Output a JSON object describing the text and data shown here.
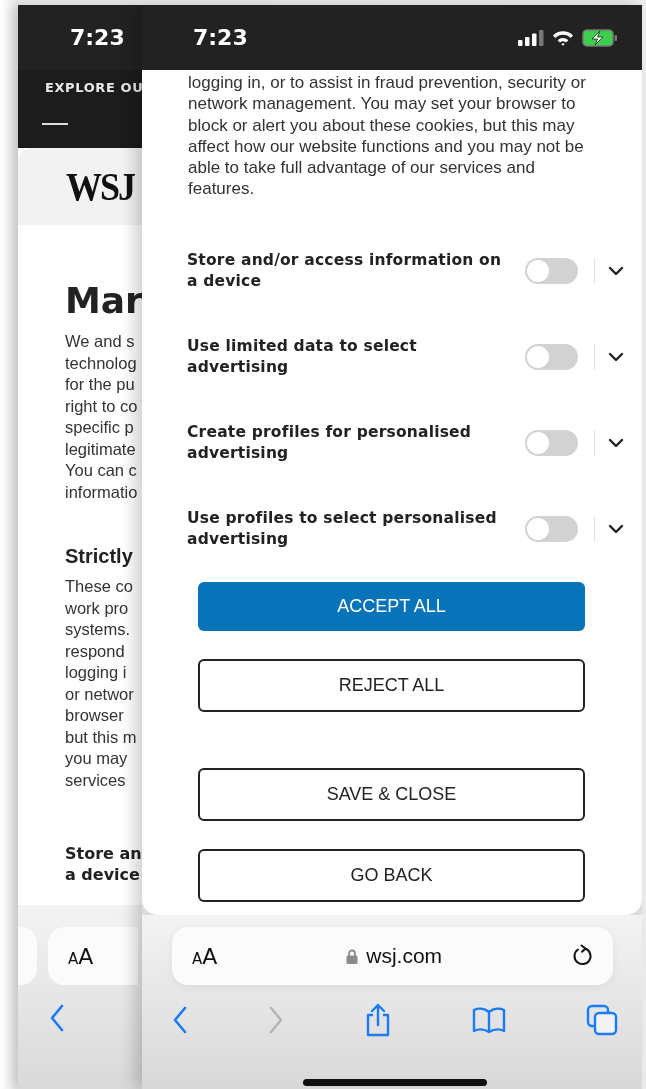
{
  "back_card": {
    "status_time": "7:23",
    "nav_label": "EXPLORE OU",
    "logo": "WSJ",
    "heading": "Mar",
    "intro_lines": [
      "We and s",
      "technolog",
      "for the pu",
      "right to co",
      "specific p",
      "legitimate",
      "You can c",
      "informatio"
    ],
    "section_title": "Strictly",
    "section_lines": [
      "These co",
      "work pro",
      "systems.",
      "respond",
      "logging i",
      "or networ",
      "browser",
      "but this m",
      "you may",
      "services"
    ],
    "purpose_lines": [
      "Store an",
      "a device"
    ],
    "text_size_button": "AA"
  },
  "front_card": {
    "status_time": "7:23",
    "notice": "logging in, or to assist in fraud prevention, security or network management. You may set your browser to block or alert you about these cookies, but this may affect how our website functions and you may not be able to take full advantage of our services and features.",
    "purposes": [
      {
        "title": "Store and/or access information on a device",
        "on": false,
        "expanded": false
      },
      {
        "title": "Use limited data to select advertising",
        "on": false,
        "expanded": false
      },
      {
        "title": "Create profiles for personalised advertising",
        "on": false,
        "expanded": false
      },
      {
        "title": "Use profiles to select personalised advertising",
        "on": false,
        "expanded": false
      }
    ],
    "buttons": [
      {
        "label": "ACCEPT ALL",
        "kind": "primary"
      },
      {
        "label": "REJECT ALL",
        "kind": "outline"
      },
      {
        "label": "SAVE & CLOSE",
        "kind": "outline"
      },
      {
        "label": "GO BACK",
        "kind": "outline"
      }
    ],
    "address_bar": {
      "text_size_button": "AA",
      "url": "wsj.com"
    },
    "toolbar": {
      "forward_disabled": true
    }
  }
}
